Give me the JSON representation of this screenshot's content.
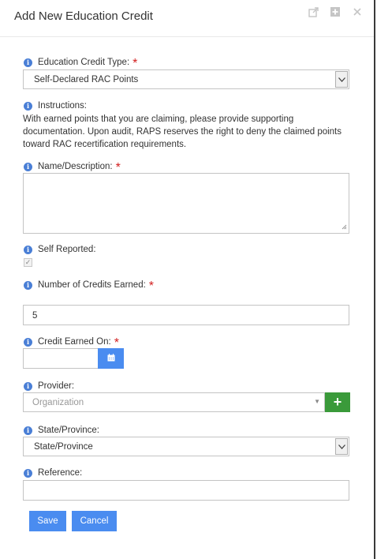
{
  "dialog": {
    "title": "Add New Education Credit",
    "header_icons": [
      "external-link-icon",
      "maximize-icon",
      "close-icon"
    ]
  },
  "fields": {
    "credit_type": {
      "label": "Education Credit Type:",
      "required_mark": "*",
      "value": "Self-Declared RAC Points"
    },
    "instructions": {
      "label": "Instructions:",
      "text": "With earned points that you are claiming, please provide supporting documentation. Upon audit, RAPS reserves the right to deny the claimed points toward RAC recertification requirements."
    },
    "name_description": {
      "label": "Name/Description:",
      "required_mark": "*",
      "value": ""
    },
    "self_reported": {
      "label": "Self Reported:",
      "checked": true,
      "check_glyph": "✓"
    },
    "credits_earned": {
      "label": "Number of Credits Earned:",
      "required_mark": "*",
      "value": "5"
    },
    "credit_earned_on": {
      "label": "Credit Earned On:",
      "required_mark": "*",
      "value": ""
    },
    "provider": {
      "label": "Provider:",
      "placeholder": "Organization",
      "add_label": "+"
    },
    "state_province": {
      "label": "State/Province:",
      "value": "State/Province"
    },
    "reference": {
      "label": "Reference:",
      "value": ""
    }
  },
  "buttons": {
    "save": "Save",
    "cancel": "Cancel"
  },
  "colors": {
    "accent": "#4a8cf0",
    "info": "#4a7fd6",
    "required": "#d21e1e",
    "add": "#3a9a3a"
  }
}
